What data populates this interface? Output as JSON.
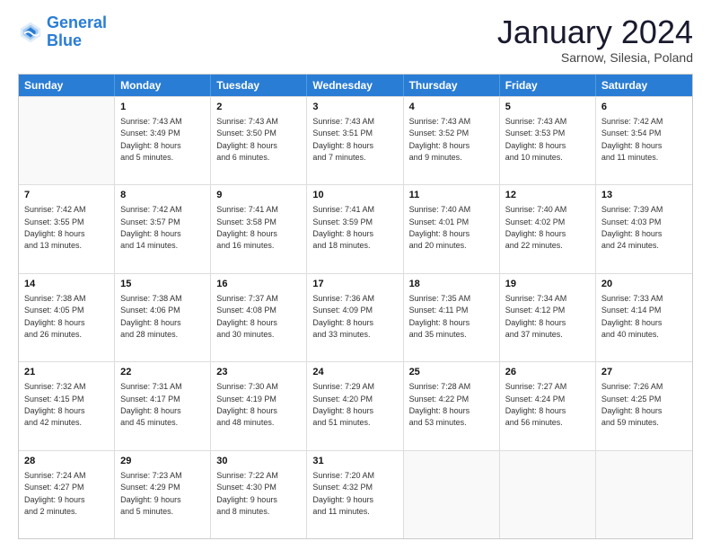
{
  "logo": {
    "line1": "General",
    "line2": "Blue"
  },
  "title": "January 2024",
  "location": "Sarnow, Silesia, Poland",
  "days": [
    "Sunday",
    "Monday",
    "Tuesday",
    "Wednesday",
    "Thursday",
    "Friday",
    "Saturday"
  ],
  "weeks": [
    [
      {
        "day": "",
        "content": ""
      },
      {
        "day": "1",
        "content": "Sunrise: 7:43 AM\nSunset: 3:49 PM\nDaylight: 8 hours\nand 5 minutes."
      },
      {
        "day": "2",
        "content": "Sunrise: 7:43 AM\nSunset: 3:50 PM\nDaylight: 8 hours\nand 6 minutes."
      },
      {
        "day": "3",
        "content": "Sunrise: 7:43 AM\nSunset: 3:51 PM\nDaylight: 8 hours\nand 7 minutes."
      },
      {
        "day": "4",
        "content": "Sunrise: 7:43 AM\nSunset: 3:52 PM\nDaylight: 8 hours\nand 9 minutes."
      },
      {
        "day": "5",
        "content": "Sunrise: 7:43 AM\nSunset: 3:53 PM\nDaylight: 8 hours\nand 10 minutes."
      },
      {
        "day": "6",
        "content": "Sunrise: 7:42 AM\nSunset: 3:54 PM\nDaylight: 8 hours\nand 11 minutes."
      }
    ],
    [
      {
        "day": "7",
        "content": "Sunrise: 7:42 AM\nSunset: 3:55 PM\nDaylight: 8 hours\nand 13 minutes."
      },
      {
        "day": "8",
        "content": "Sunrise: 7:42 AM\nSunset: 3:57 PM\nDaylight: 8 hours\nand 14 minutes."
      },
      {
        "day": "9",
        "content": "Sunrise: 7:41 AM\nSunset: 3:58 PM\nDaylight: 8 hours\nand 16 minutes."
      },
      {
        "day": "10",
        "content": "Sunrise: 7:41 AM\nSunset: 3:59 PM\nDaylight: 8 hours\nand 18 minutes."
      },
      {
        "day": "11",
        "content": "Sunrise: 7:40 AM\nSunset: 4:01 PM\nDaylight: 8 hours\nand 20 minutes."
      },
      {
        "day": "12",
        "content": "Sunrise: 7:40 AM\nSunset: 4:02 PM\nDaylight: 8 hours\nand 22 minutes."
      },
      {
        "day": "13",
        "content": "Sunrise: 7:39 AM\nSunset: 4:03 PM\nDaylight: 8 hours\nand 24 minutes."
      }
    ],
    [
      {
        "day": "14",
        "content": "Sunrise: 7:38 AM\nSunset: 4:05 PM\nDaylight: 8 hours\nand 26 minutes."
      },
      {
        "day": "15",
        "content": "Sunrise: 7:38 AM\nSunset: 4:06 PM\nDaylight: 8 hours\nand 28 minutes."
      },
      {
        "day": "16",
        "content": "Sunrise: 7:37 AM\nSunset: 4:08 PM\nDaylight: 8 hours\nand 30 minutes."
      },
      {
        "day": "17",
        "content": "Sunrise: 7:36 AM\nSunset: 4:09 PM\nDaylight: 8 hours\nand 33 minutes."
      },
      {
        "day": "18",
        "content": "Sunrise: 7:35 AM\nSunset: 4:11 PM\nDaylight: 8 hours\nand 35 minutes."
      },
      {
        "day": "19",
        "content": "Sunrise: 7:34 AM\nSunset: 4:12 PM\nDaylight: 8 hours\nand 37 minutes."
      },
      {
        "day": "20",
        "content": "Sunrise: 7:33 AM\nSunset: 4:14 PM\nDaylight: 8 hours\nand 40 minutes."
      }
    ],
    [
      {
        "day": "21",
        "content": "Sunrise: 7:32 AM\nSunset: 4:15 PM\nDaylight: 8 hours\nand 42 minutes."
      },
      {
        "day": "22",
        "content": "Sunrise: 7:31 AM\nSunset: 4:17 PM\nDaylight: 8 hours\nand 45 minutes."
      },
      {
        "day": "23",
        "content": "Sunrise: 7:30 AM\nSunset: 4:19 PM\nDaylight: 8 hours\nand 48 minutes."
      },
      {
        "day": "24",
        "content": "Sunrise: 7:29 AM\nSunset: 4:20 PM\nDaylight: 8 hours\nand 51 minutes."
      },
      {
        "day": "25",
        "content": "Sunrise: 7:28 AM\nSunset: 4:22 PM\nDaylight: 8 hours\nand 53 minutes."
      },
      {
        "day": "26",
        "content": "Sunrise: 7:27 AM\nSunset: 4:24 PM\nDaylight: 8 hours\nand 56 minutes."
      },
      {
        "day": "27",
        "content": "Sunrise: 7:26 AM\nSunset: 4:25 PM\nDaylight: 8 hours\nand 59 minutes."
      }
    ],
    [
      {
        "day": "28",
        "content": "Sunrise: 7:24 AM\nSunset: 4:27 PM\nDaylight: 9 hours\nand 2 minutes."
      },
      {
        "day": "29",
        "content": "Sunrise: 7:23 AM\nSunset: 4:29 PM\nDaylight: 9 hours\nand 5 minutes."
      },
      {
        "day": "30",
        "content": "Sunrise: 7:22 AM\nSunset: 4:30 PM\nDaylight: 9 hours\nand 8 minutes."
      },
      {
        "day": "31",
        "content": "Sunrise: 7:20 AM\nSunset: 4:32 PM\nDaylight: 9 hours\nand 11 minutes."
      },
      {
        "day": "",
        "content": ""
      },
      {
        "day": "",
        "content": ""
      },
      {
        "day": "",
        "content": ""
      }
    ]
  ]
}
